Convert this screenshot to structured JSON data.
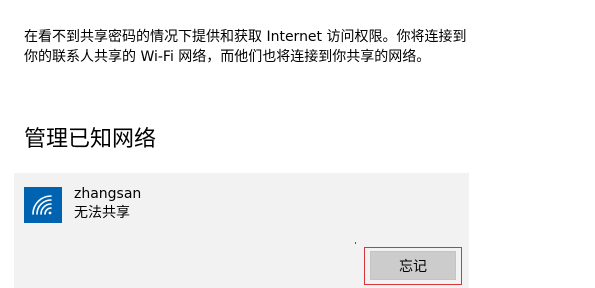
{
  "description": "在看不到共享密码的情况下提供和获取 Internet 访问权限。你将连接到你的联系人共享的 Wi-Fi 网络，而他们也将连接到你共享的网络。",
  "section_title": "管理已知网络",
  "network": {
    "name": "zhangsan",
    "status": "无法共享",
    "icon": "wifi-icon"
  },
  "forget_button_label": "忘记",
  "colors": {
    "accent": "#0063b1",
    "card_background": "#f2f2f2",
    "button_background": "#cccccc",
    "focus_border": "#d8353a"
  }
}
